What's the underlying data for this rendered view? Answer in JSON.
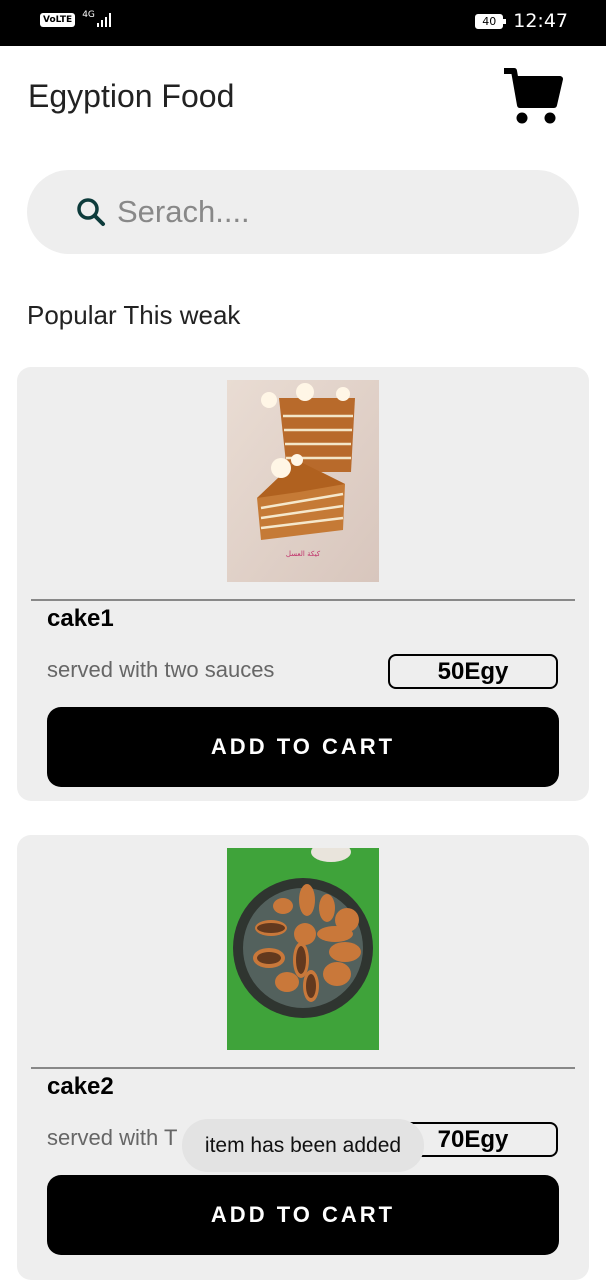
{
  "status_bar": {
    "volte": "VoLTE",
    "network": "4G",
    "battery": "40",
    "time": "12:47"
  },
  "app": {
    "title": "Egyption Food",
    "cart_icon": "shopping-cart-icon"
  },
  "search": {
    "icon": "search-icon",
    "placeholder": "Serach....",
    "value": ""
  },
  "section_title": "Popular This weak",
  "products": [
    {
      "name": "cake1",
      "description": "served with two sauces",
      "price": "50Egy",
      "button_label": "ADD TO CART",
      "image_caption": "كيكة العسل"
    },
    {
      "name": "cake2",
      "description": "served with T",
      "price": "70Egy",
      "button_label": "ADD TO CART"
    }
  ],
  "toast": "item has been added",
  "colors": {
    "card_background": "#eeeeee",
    "button": "#000000",
    "button_text": "#ffffff"
  }
}
